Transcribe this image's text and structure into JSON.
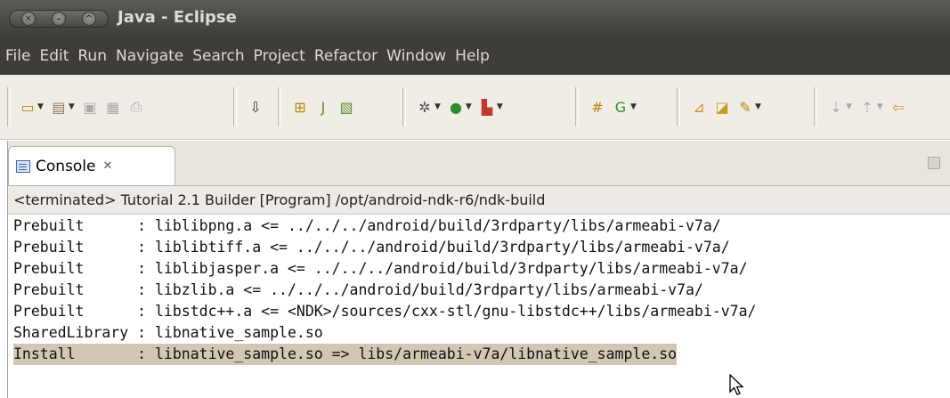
{
  "window": {
    "title": "Java - Eclipse"
  },
  "menu": [
    "File",
    "Edit",
    "Run",
    "Navigate",
    "Search",
    "Project",
    "Refactor",
    "Window",
    "Help"
  ],
  "console_tab": {
    "label": "Console",
    "close_glyph": "✕"
  },
  "status_line": "<terminated> Tutorial 2.1 Builder [Program] /opt/android-ndk-r6/ndk-build",
  "console_lines": [
    {
      "kind": "Prebuilt",
      "text": ": liblibpng.a <= ../../../android/build/3rdparty/libs/armeabi-v7a/"
    },
    {
      "kind": "Prebuilt",
      "text": ": liblibtiff.a <= ../../../android/build/3rdparty/libs/armeabi-v7a/"
    },
    {
      "kind": "Prebuilt",
      "text": ": liblibjasper.a <= ../../../android/build/3rdparty/libs/armeabi-v7a/"
    },
    {
      "kind": "Prebuilt",
      "text": ": libzlib.a <= ../../../android/build/3rdparty/libs/armeabi-v7a/"
    },
    {
      "kind": "Prebuilt",
      "text": ": libstdc++.a <= <NDK>/sources/cxx-stl/gnu-libstdc++/libs/armeabi-v7a/"
    },
    {
      "kind": "SharedLibrary",
      "text": ": libnative_sample.so"
    },
    {
      "kind": "Install",
      "text": ": libnative_sample.so => libs/armeabi-v7a/libnative_sample.so"
    }
  ]
}
